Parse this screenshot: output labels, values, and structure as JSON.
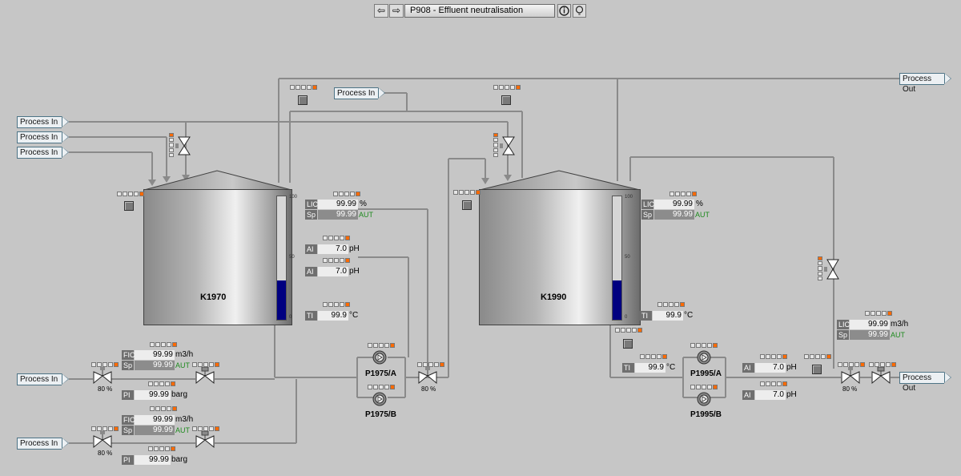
{
  "nav": {
    "title": "P908  - Effluent neutralisation"
  },
  "process_labels": {
    "in": "Process In",
    "out": "Process Out"
  },
  "tanks": [
    {
      "name": "K1970",
      "level_fraction": 0.32,
      "scale": {
        "top": "100",
        "mid": "50",
        "bottom": "0"
      }
    },
    {
      "name": "K1990",
      "level_fraction": 0.32,
      "scale": {
        "top": "100",
        "mid": "50",
        "bottom": "0"
      }
    }
  ],
  "tags": {
    "lic_1970": {
      "tag": "LIC",
      "value": "99.99",
      "unit": "%"
    },
    "sp_1970": {
      "tag": "Sp",
      "value": "99.99",
      "mode": "AUT"
    },
    "ai_1970_a": {
      "tag": "AI",
      "value": "7.0",
      "unit": "pH"
    },
    "ai_1970_b": {
      "tag": "AI",
      "value": "7.0",
      "unit": "pH"
    },
    "ti_1970": {
      "tag": "TI",
      "value": "99.9",
      "unit": "°C"
    },
    "lic_1990": {
      "tag": "LIC",
      "value": "99.99",
      "unit": "%"
    },
    "sp_1990": {
      "tag": "Sp",
      "value": "99.99",
      "mode": "AUT"
    },
    "ti_1990": {
      "tag": "TI",
      "value": "99.9",
      "unit": "°C"
    },
    "ti_outlet": {
      "tag": "TI",
      "value": "99.9",
      "unit": "°C"
    },
    "ai_out_a": {
      "tag": "AI",
      "value": "7.0",
      "unit": "pH"
    },
    "ai_out_b": {
      "tag": "AI",
      "value": "7.0",
      "unit": "pH"
    },
    "lic_out": {
      "tag": "LIC",
      "value": "99.99",
      "unit": "m3/h"
    },
    "sp_out": {
      "tag": "Sp",
      "value": "99.99",
      "mode": "AUT"
    },
    "fic_1": {
      "tag": "FIC",
      "value": "99.99",
      "unit": "m3/h"
    },
    "sp_fic_1": {
      "tag": "Sp",
      "value": "99.99",
      "mode": "AUT"
    },
    "pi_1": {
      "tag": "PI",
      "value": "99.99",
      "unit": "barg"
    },
    "fic_2": {
      "tag": "FIC",
      "value": "99.99",
      "unit": "m3/h"
    },
    "sp_fic_2": {
      "tag": "Sp",
      "value": "99.99",
      "mode": "AUT"
    },
    "pi_2": {
      "tag": "PI",
      "value": "99.99",
      "unit": "barg"
    }
  },
  "valve_openings": {
    "v1": "80 %",
    "v2": "80 %",
    "v3": "80 %",
    "v4": "80 %"
  },
  "pumps": {
    "p1975a": "P1975/A",
    "p1975b": "P1975/B",
    "p1995a": "P1995/A",
    "p1995b": "P1995/B"
  },
  "colors": {
    "background": "#c6c6c6",
    "level_fill": "#000080",
    "status_alarm": "#ff6a00",
    "mode_text": "#1e8a1e"
  }
}
